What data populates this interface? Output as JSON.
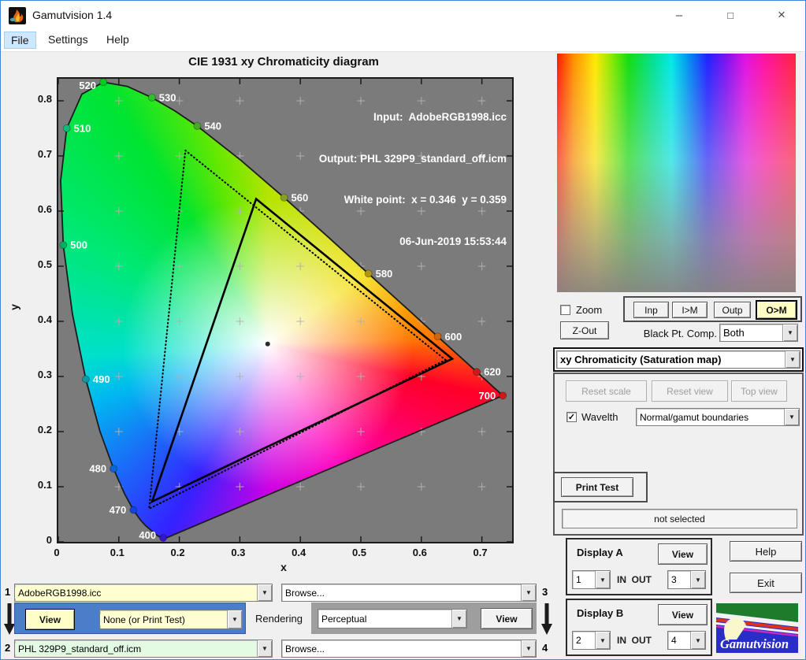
{
  "window": {
    "title": "Gamutvision 1.4",
    "minimize": "–",
    "maximize": "□",
    "close": "×"
  },
  "menu": {
    "items": [
      {
        "label": "File"
      },
      {
        "label": "Settings"
      },
      {
        "label": "Help"
      }
    ]
  },
  "chart_data": {
    "type": "scatter",
    "title": "CIE 1931 xy Chromaticity diagram",
    "xlabel": "x",
    "ylabel": "y",
    "xlim": [
      0,
      0.75
    ],
    "ylim": [
      0,
      0.84
    ],
    "xticks": [
      0,
      0.1,
      0.2,
      0.3,
      0.4,
      0.5,
      0.6,
      0.7
    ],
    "yticks": [
      0,
      0.1,
      0.2,
      0.3,
      0.4,
      0.5,
      0.6,
      0.7,
      0.8
    ],
    "grid": "plus-marks at every 0.1",
    "info_lines": [
      "Input:  AdobeRGB1998.icc",
      "Output: PHL 329P9_standard_off.icm",
      "White point:  x = 0.346  y = 0.359",
      "06-Jun-2019 15:53:44"
    ],
    "white_point": {
      "x": 0.346,
      "y": 0.359
    },
    "spectral_locus": [
      [
        0.1733,
        0.0048
      ],
      [
        0.1689,
        0.0086
      ],
      [
        0.1644,
        0.0109
      ],
      [
        0.1566,
        0.0177
      ],
      [
        0.144,
        0.0297
      ],
      [
        0.1355,
        0.0399
      ],
      [
        0.1241,
        0.0578
      ],
      [
        0.1096,
        0.0868
      ],
      [
        0.0913,
        0.1327
      ],
      [
        0.0687,
        0.2007
      ],
      [
        0.0454,
        0.295
      ],
      [
        0.0235,
        0.4127
      ],
      [
        0.0082,
        0.5384
      ],
      [
        0.0039,
        0.6548
      ],
      [
        0.0139,
        0.7502
      ],
      [
        0.0389,
        0.812
      ],
      [
        0.0743,
        0.8338
      ],
      [
        0.1142,
        0.8262
      ],
      [
        0.1547,
        0.8059
      ],
      [
        0.1929,
        0.7816
      ],
      [
        0.2296,
        0.7543
      ],
      [
        0.3016,
        0.6923
      ],
      [
        0.3731,
        0.6245
      ],
      [
        0.4441,
        0.5547
      ],
      [
        0.5125,
        0.4866
      ],
      [
        0.5752,
        0.4242
      ],
      [
        0.627,
        0.3725
      ],
      [
        0.6658,
        0.334
      ],
      [
        0.6915,
        0.3083
      ],
      [
        0.7079,
        0.292
      ],
      [
        0.719,
        0.2809
      ],
      [
        0.726,
        0.274
      ],
      [
        0.7347,
        0.2653
      ]
    ],
    "wavelength_markers": [
      {
        "nm": "400",
        "x": 0.1733,
        "y": 0.0048,
        "color": "#3a14c8",
        "side": "left"
      },
      {
        "nm": "470",
        "x": 0.1241,
        "y": 0.0578,
        "color": "#1244dc",
        "side": "left"
      },
      {
        "nm": "480",
        "x": 0.0913,
        "y": 0.1327,
        "color": "#0e66d4",
        "side": "left"
      },
      {
        "nm": "490",
        "x": 0.0454,
        "y": 0.295,
        "color": "#0a9aa0",
        "side": "right"
      },
      {
        "nm": "500",
        "x": 0.0082,
        "y": 0.5384,
        "color": "#00ae62",
        "side": "right"
      },
      {
        "nm": "510",
        "x": 0.0139,
        "y": 0.7502,
        "color": "#12b876",
        "side": "right"
      },
      {
        "nm": "520",
        "x": 0.0743,
        "y": 0.8338,
        "color": "#00cc22",
        "side": "left"
      },
      {
        "nm": "530",
        "x": 0.1547,
        "y": 0.8059,
        "color": "#2ec02e",
        "side": "right"
      },
      {
        "nm": "540",
        "x": 0.2296,
        "y": 0.7543,
        "color": "#46aa28",
        "side": "right"
      },
      {
        "nm": "560",
        "x": 0.3731,
        "y": 0.6245,
        "color": "#86a024",
        "side": "right"
      },
      {
        "nm": "580",
        "x": 0.5125,
        "y": 0.4866,
        "color": "#ae9612",
        "side": "right"
      },
      {
        "nm": "600",
        "x": 0.627,
        "y": 0.3725,
        "color": "#d06410",
        "side": "right"
      },
      {
        "nm": "620",
        "x": 0.6915,
        "y": 0.3083,
        "color": "#cc1a1a",
        "side": "right"
      },
      {
        "nm": "700",
        "x": 0.7347,
        "y": 0.2653,
        "color": "#cc1a1a",
        "side": "left"
      }
    ],
    "gamuts": [
      {
        "name": "input-gamut-dotted",
        "style": "dotted",
        "vertices": [
          [
            0.64,
            0.33
          ],
          [
            0.21,
            0.71
          ],
          [
            0.15,
            0.06
          ]
        ]
      },
      {
        "name": "output-gamut-solid",
        "style": "solid",
        "vertices": [
          [
            0.651,
            0.332
          ],
          [
            0.327,
            0.622
          ],
          [
            0.155,
            0.073
          ]
        ]
      }
    ],
    "hue_stops": [
      "#b4e400 0deg",
      "#f4dc00 55deg",
      "#ff7800 88deg",
      "#ff0028 103deg",
      "#ff00bc 150deg",
      "#cc00e4 180deg",
      "#3422ff 208deg",
      "#00b8f0 252deg",
      "#00e0cc 266deg",
      "#00e874 300deg",
      "#00e430 328deg",
      "#66e800 345deg",
      "#b4e400 360deg"
    ],
    "white_radius_px": 185
  },
  "sat_map": {
    "hue_stops": "#ff1800 0%, #ff9000 7%, #ffe800 16%, #88e800 23%, #10dd10 30%, #00e090 40%, #00e8e8 48%, #0090f0 55%, #2020ff 63%, #8010f0 71%, #e010e0 79%, #ff10a0 87%, #ff2040 100%",
    "fade_stops": "rgba(255,255,255,0) 0%, rgba(236,232,230,0.35) 45%, rgba(165,160,157,0.75) 78%, rgba(138,134,132,0.95) 100%"
  },
  "right_panel": {
    "zoom_label": "Zoom",
    "mode_buttons": [
      "Inp",
      "I>M",
      "Outp",
      "O>M"
    ],
    "zout_label": "Z-Out",
    "black_pt_label": "Black Pt. Comp.",
    "black_pt_value": "Both",
    "view_mode_value": "xy Chromaticity (Saturation map)",
    "reset_buttons": [
      "Reset scale",
      "Reset view",
      "Top view"
    ],
    "wavelth_label": "Wavelth",
    "wavelth_check": "✓",
    "boundaries_value": "Normal/gamut boundaries",
    "print_test_label": "Print Test",
    "status_text": "not selected",
    "display_a": {
      "title": "Display A",
      "view_label": "View",
      "in_value": "1",
      "inout_label": "IN  OUT",
      "out_value": "3"
    },
    "display_b": {
      "title": "Display B",
      "view_label": "View",
      "in_value": "2",
      "inout_label": "IN  OUT",
      "out_value": "4"
    },
    "help_label": "Help",
    "exit_label": "Exit",
    "logo_text": "Gamutvision"
  },
  "bottom": {
    "row1_num": "1",
    "row1_file": "AdobeRGB1998.icc",
    "row1_browse": "Browse...",
    "row1_num_right": "3",
    "view_left_label": "View",
    "intent_none_value": "None (or Print Test)",
    "rendering_label": "Rendering",
    "intent_value": "Perceptual",
    "view_right_label": "View",
    "row2_num": "2",
    "row2_file": "PHL 329P9_standard_off.icm",
    "row2_browse": "Browse...",
    "row2_num_right": "4"
  },
  "colors": {
    "plot_bg": "#7b7b7b",
    "figure_bg": "#f0f0f0",
    "combo_yellow": "#ffffd2",
    "combo_green": "#e2fbe2",
    "selected_button_yellow": "#ffffc4",
    "blue_panel": "#4a7ec8",
    "window_border_blue": "#3f87d6"
  }
}
